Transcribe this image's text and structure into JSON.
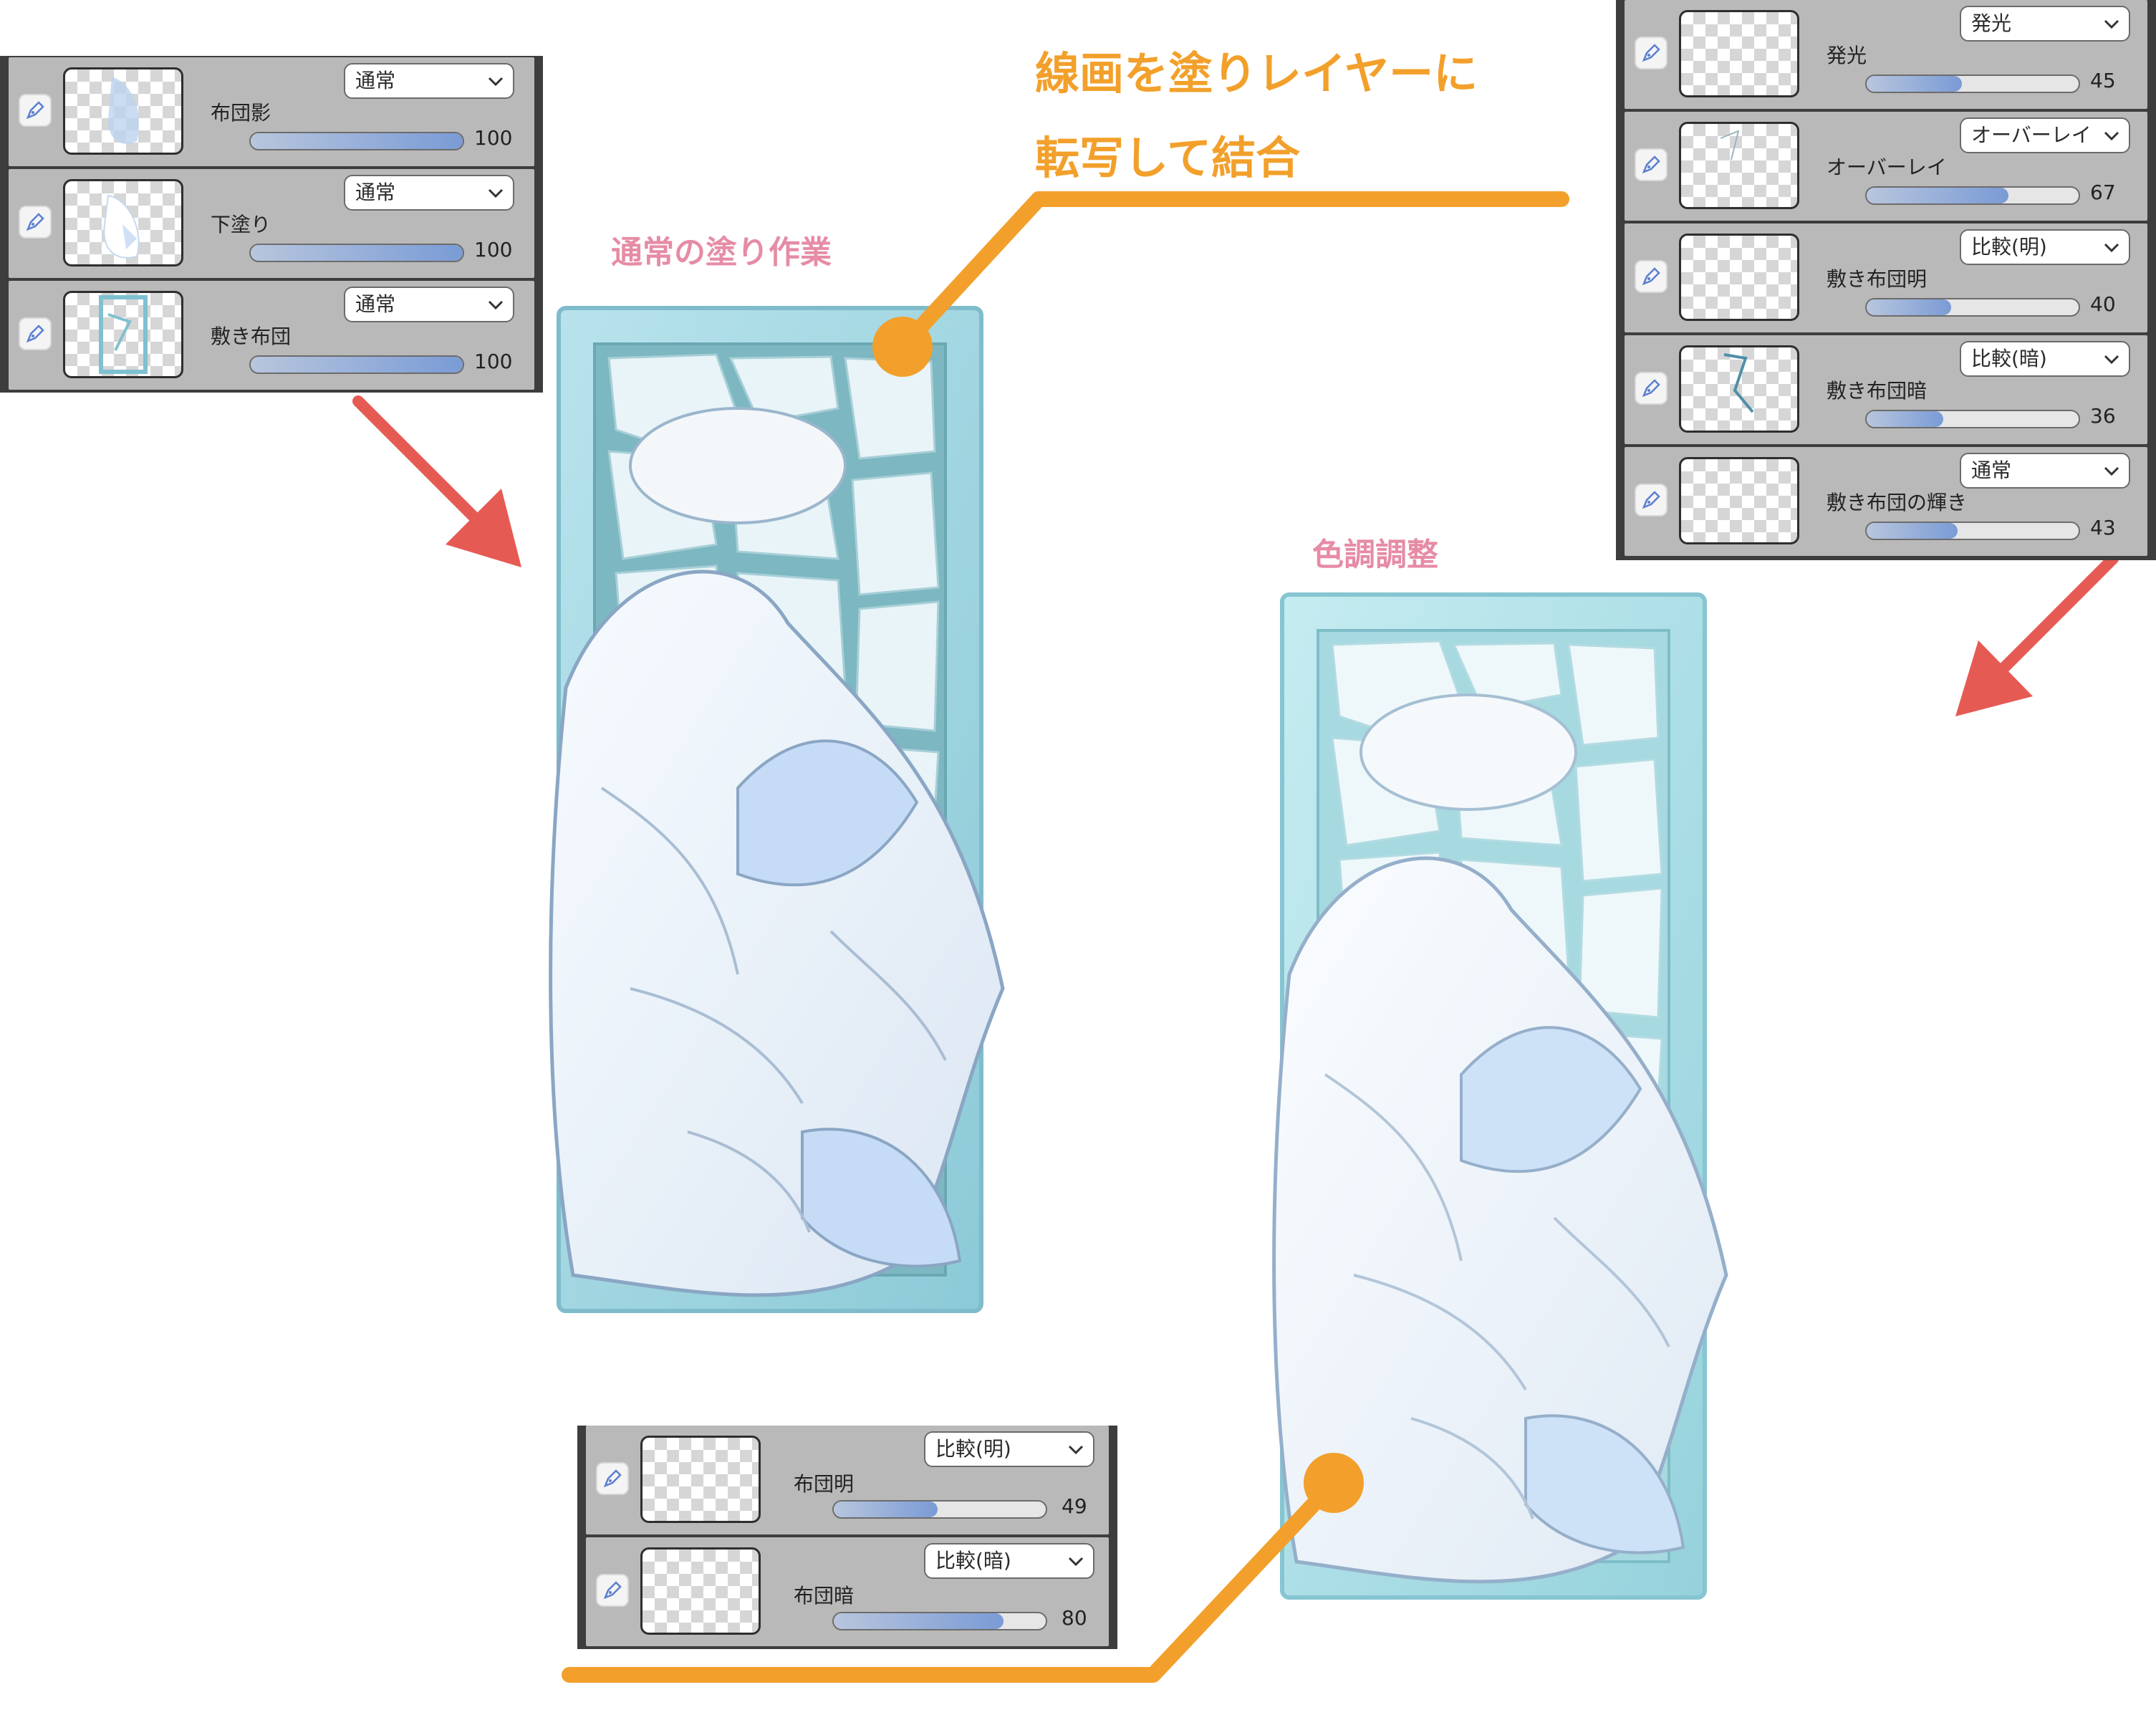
{
  "annotations": {
    "normal_paint": "通常の塗り作業",
    "tone_adjust": "色調調整",
    "lineart_line1": "線画を塗りレイヤーに",
    "lineart_line2": "転写して結合"
  },
  "colors": {
    "accent_orange": "#f2a02b",
    "arrow_red": "#e55b54",
    "label_pink": "#e68ca5",
    "ice_blue": "#9fd3de",
    "slider_fill": "#7a9bd6"
  },
  "panel_top_left": {
    "layers": [
      {
        "name": "布団影",
        "mode": "通常",
        "opacity": "100",
        "fill": 1.0
      },
      {
        "name": "下塗り",
        "mode": "通常",
        "opacity": "100",
        "fill": 1.0
      },
      {
        "name": "敷き布団",
        "mode": "通常",
        "opacity": "100",
        "fill": 1.0
      }
    ]
  },
  "panel_top_right": {
    "layers": [
      {
        "name": "発光",
        "mode": "発光",
        "opacity": "45",
        "fill": 0.45
      },
      {
        "name": "オーバーレイ",
        "mode": "オーバーレイ",
        "opacity": "67",
        "fill": 0.67
      },
      {
        "name": "敷き布団明",
        "mode": "比較(明)",
        "opacity": "40",
        "fill": 0.4
      },
      {
        "name": "敷き布団暗",
        "mode": "比較(暗)",
        "opacity": "36",
        "fill": 0.36
      },
      {
        "name": "敷き布団の輝き",
        "mode": "通常",
        "opacity": "43",
        "fill": 0.43
      }
    ]
  },
  "panel_bottom": {
    "layers": [
      {
        "name": "布団明",
        "mode": "比較(明)",
        "opacity": "49",
        "fill": 0.49
      },
      {
        "name": "布団暗",
        "mode": "比較(暗)",
        "opacity": "80",
        "fill": 0.8
      }
    ]
  }
}
